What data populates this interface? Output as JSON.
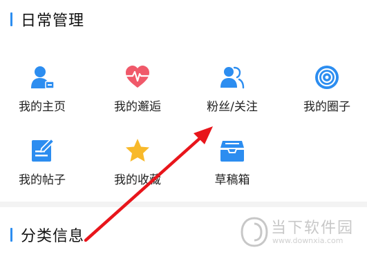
{
  "sections": {
    "daily": {
      "title": "日常管理"
    },
    "category": {
      "title": "分类信息"
    }
  },
  "grid": {
    "items": [
      {
        "label": "我的主页",
        "icon": "user-card-icon"
      },
      {
        "label": "我的邂逅",
        "icon": "heartbeat-icon"
      },
      {
        "label": "粉丝/关注",
        "icon": "followers-icon"
      },
      {
        "label": "我的圈子",
        "icon": "circle-target-icon"
      },
      {
        "label": "我的帖子",
        "icon": "edit-post-icon"
      },
      {
        "label": "我的收藏",
        "icon": "star-icon"
      },
      {
        "label": "草稿箱",
        "icon": "drafts-tray-icon"
      }
    ]
  },
  "watermark": {
    "name": "当下软件园",
    "url": "www.downxia.com"
  },
  "colors": {
    "accent_blue": "#2c8df0",
    "heart_red": "#f0596a",
    "star_yellow": "#f8b92a",
    "arrow_red": "#e8151b"
  }
}
